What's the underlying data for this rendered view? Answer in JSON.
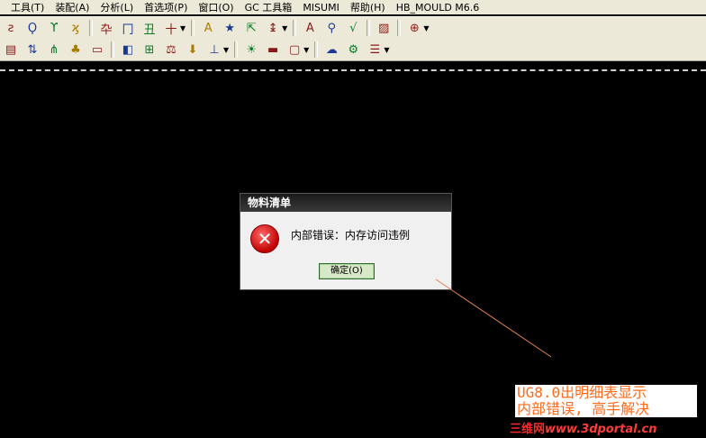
{
  "menu": [
    "工具(T)",
    "装配(A)",
    "分析(L)",
    "首选项(P)",
    "窗口(O)",
    "GC 工具箱",
    "MISUMI",
    "帮助(H)",
    "HB_MOULD M6.6"
  ],
  "toolbar1": [
    {
      "icon": "curve-icon",
      "glyph": "ƨ"
    },
    {
      "icon": "fillet-icon",
      "glyph": "Ϙ"
    },
    {
      "icon": "trim-icon",
      "glyph": "ϒ"
    },
    {
      "icon": "extend-icon",
      "glyph": "ϗ"
    },
    {
      "icon": "offset-icon",
      "glyph": "卆"
    },
    {
      "icon": "dimension-icon",
      "glyph": "冂"
    },
    {
      "icon": "section-icon",
      "glyph": "丑"
    },
    {
      "icon": "crosshair-icon",
      "glyph": "十"
    },
    {
      "icon": "text-style-icon",
      "glyph": "A"
    },
    {
      "icon": "star-icon",
      "glyph": "★"
    },
    {
      "icon": "hide-icon",
      "glyph": "⇱"
    },
    {
      "icon": "measure-icon",
      "glyph": "↨"
    },
    {
      "icon": "annotation-a-icon",
      "glyph": "A"
    },
    {
      "icon": "search-icon",
      "glyph": "⚲"
    },
    {
      "icon": "check-icon",
      "glyph": "√"
    },
    {
      "icon": "hatch-icon",
      "glyph": "▨"
    },
    {
      "icon": "target-icon",
      "glyph": "⊕"
    }
  ],
  "toolbar2": [
    {
      "icon": "table-icon",
      "glyph": "▤"
    },
    {
      "icon": "sort-icon",
      "glyph": "⇅"
    },
    {
      "icon": "branch-icon",
      "glyph": "⋔"
    },
    {
      "icon": "tree-icon",
      "glyph": "♣"
    },
    {
      "icon": "part-icon",
      "glyph": "▭"
    },
    {
      "icon": "flag-icon",
      "glyph": "◧"
    },
    {
      "icon": "grid-icon",
      "glyph": "⊞"
    },
    {
      "icon": "scale-icon",
      "glyph": "⚖"
    },
    {
      "icon": "download-icon",
      "glyph": "⬇"
    },
    {
      "icon": "pin-icon",
      "glyph": "⊥"
    },
    {
      "icon": "light-icon",
      "glyph": "☀"
    },
    {
      "icon": "window-icon",
      "glyph": "▬"
    },
    {
      "icon": "frame-icon",
      "glyph": "▢"
    },
    {
      "icon": "cloud-icon",
      "glyph": "☁"
    },
    {
      "icon": "gear-icon",
      "glyph": "⚙"
    },
    {
      "icon": "list-icon",
      "glyph": "☰"
    }
  ],
  "dialog": {
    "title": "物料清单",
    "message": "内部错误：内存访问违例",
    "ok_label": "确定(O)",
    "icon_glyph": "✕"
  },
  "annotation": {
    "line1": "UG8.0出明细表显示",
    "line2": "内部错误, 高手解决"
  },
  "watermark": {
    "brand": "三维网",
    "site": "www.3dportal.cn"
  },
  "colors": {
    "annotation_text": "#ff6a1a",
    "leader_line": "#e08050",
    "error_icon": "#c00000"
  }
}
